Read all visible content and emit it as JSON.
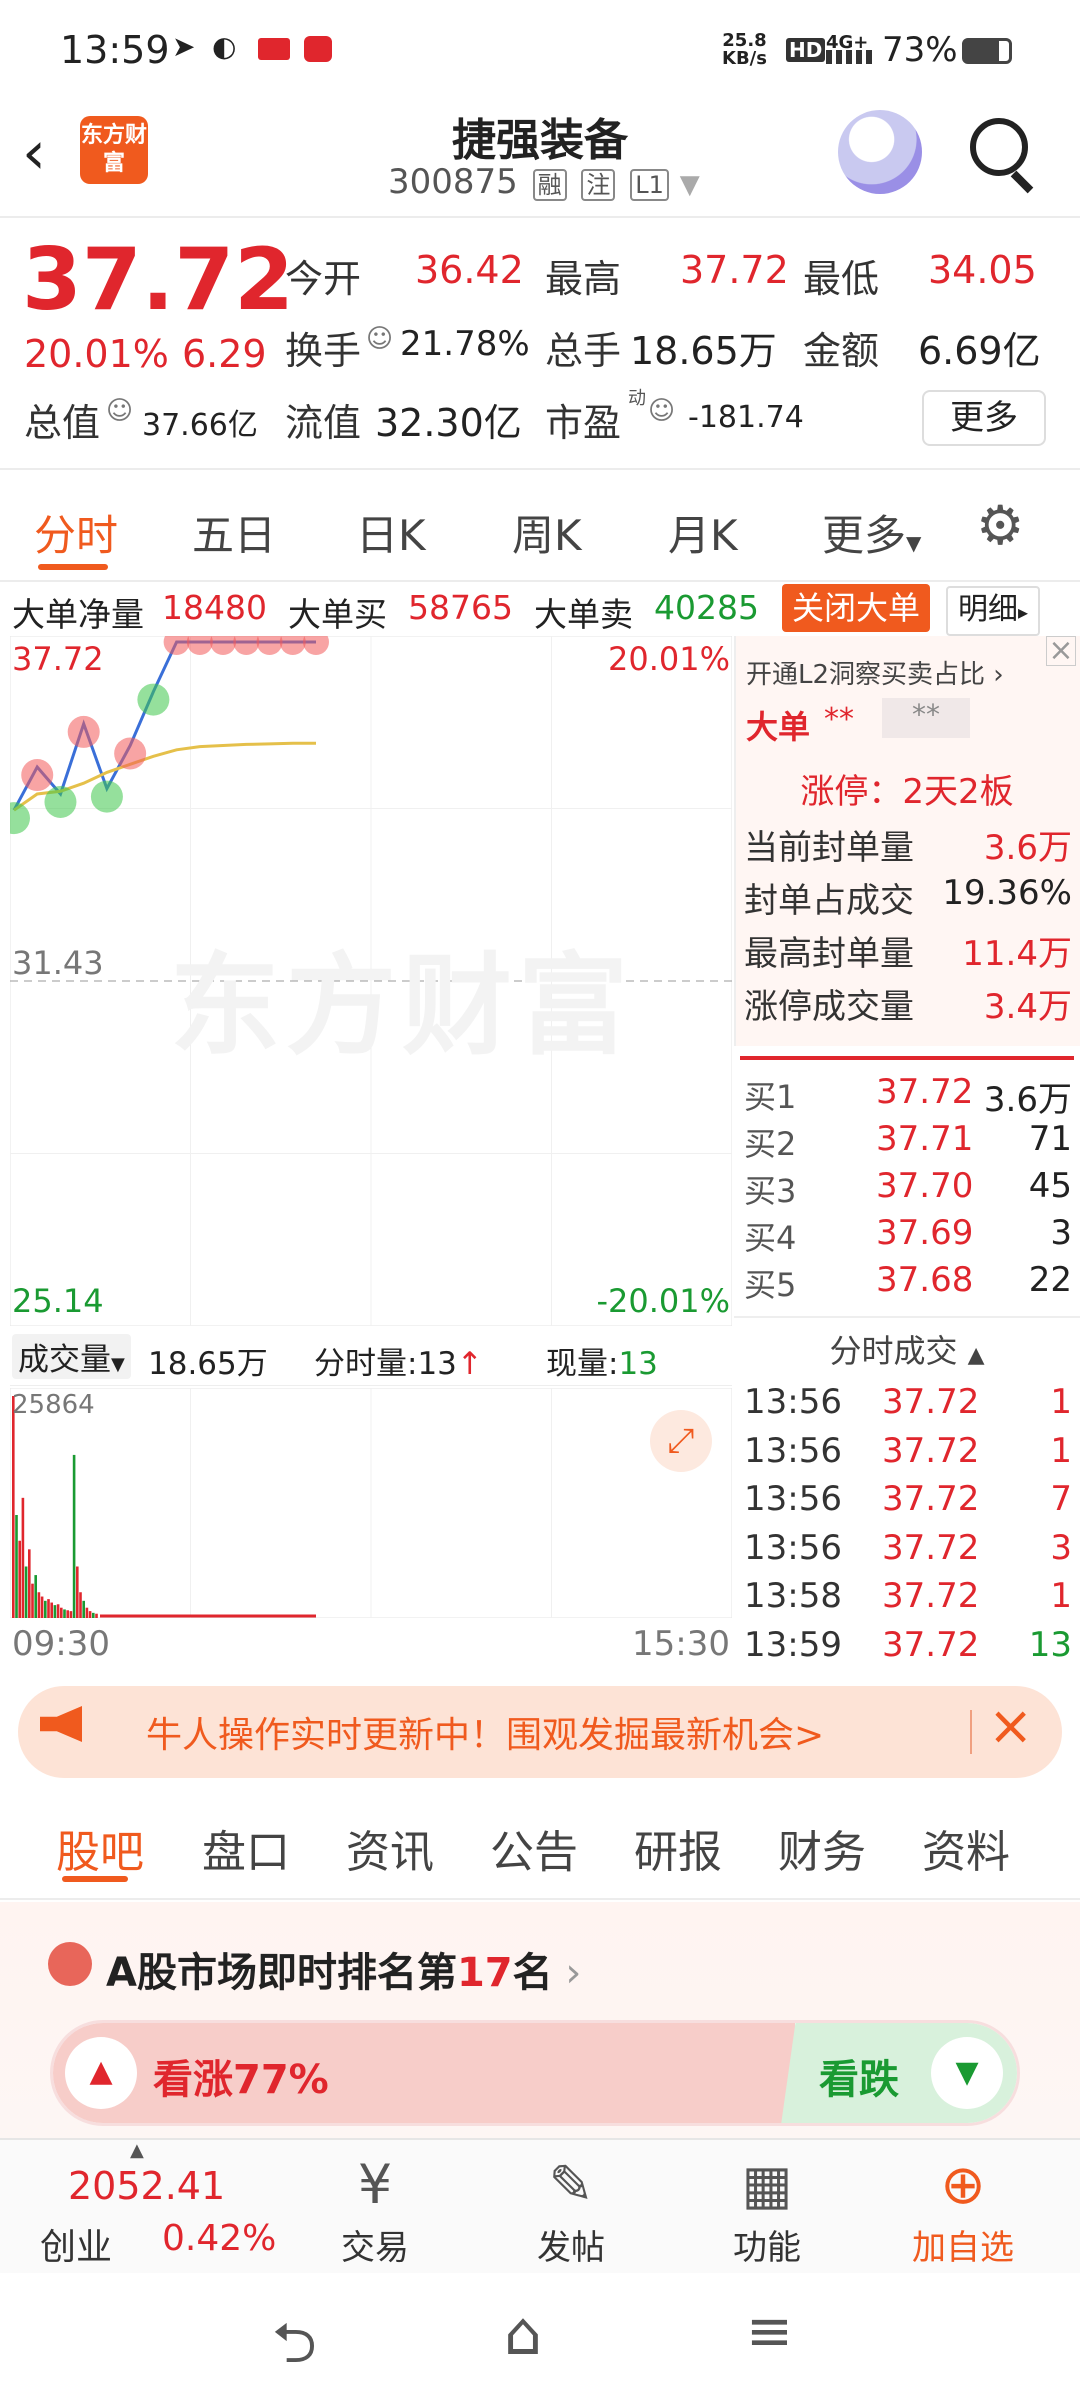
{
  "status_bar": {
    "time": "13:59",
    "net_speed_top": "25.8",
    "net_speed_bottom": "KB/s",
    "hd": "HD",
    "signal": "4G+",
    "battery": "73%"
  },
  "header": {
    "logo_text": "东方财富",
    "stock_name": "捷强装备",
    "stock_code": "300875",
    "tags": [
      "融",
      "注",
      "L1"
    ]
  },
  "quote": {
    "price": "37.72",
    "change_pct": "20.01%",
    "change_amt": "6.29",
    "labels": {
      "open": "今开",
      "high": "最高",
      "low": "最低",
      "turnover": "换手",
      "volume": "总手",
      "amount": "金额",
      "mktcap": "总值",
      "float_cap": "流值",
      "pe": "市盈",
      "pe_sup": "动"
    },
    "open": "36.42",
    "high": "37.72",
    "low": "34.05",
    "turnover": "21.78%",
    "volume": "18.65万",
    "amount": "6.69亿",
    "mktcap": "37.66亿",
    "float_cap": "32.30亿",
    "pe": "-181.74",
    "more_button": "更多"
  },
  "chart_tabs": [
    "分时",
    "五日",
    "日K",
    "周K",
    "月K",
    "更多"
  ],
  "big_order": {
    "net_label": "大单净量",
    "net_value": "18480",
    "buy_label": "大单买",
    "buy_value": "58765",
    "sell_label": "大单卖",
    "sell_value": "40285",
    "close_label": "关闭大单",
    "detail_label": "明细"
  },
  "chart_data": {
    "type": "line",
    "y_labels": {
      "top": "37.72",
      "mid": "31.43",
      "bottom": "25.14"
    },
    "pct_labels": {
      "top": "20.01%",
      "bottom": "-20.01%"
    },
    "x_labels": [
      "09:30",
      "15:30"
    ],
    "watermark": "东方财富",
    "ylim": [
      25.14,
      37.72
    ],
    "prev_close": 31.43,
    "price_series": [
      34.6,
      35.4,
      34.9,
      36.2,
      35.0,
      35.8,
      36.8,
      37.72,
      37.72,
      37.72,
      37.72,
      37.72,
      37.72,
      37.72
    ],
    "avg_series": [
      34.6,
      34.9,
      34.95,
      35.1,
      35.3,
      35.45,
      35.6,
      35.72,
      35.78,
      35.8,
      35.82,
      35.83,
      35.84,
      35.84
    ],
    "volume_max_label": "25864",
    "volume": [
      25864,
      12000,
      9000,
      14000,
      6000,
      8000,
      4000,
      5000,
      3000,
      2500,
      2000,
      2200,
      1800,
      1500,
      1600,
      1200,
      1000,
      900,
      800,
      19000,
      6000,
      3000,
      2000,
      1200,
      800,
      600,
      500
    ]
  },
  "volume_bar": {
    "label": "成交量",
    "value": "18.65万",
    "tick_label": "分时量:13",
    "now_label": "现量:",
    "now_value": "13"
  },
  "l2": {
    "title": "开通L2洞察买卖占比",
    "big_label": "大单",
    "big_v1": "**",
    "big_v2": "**"
  },
  "limit_up": {
    "title": "涨停：2天2板",
    "rows": [
      [
        "当前封单量",
        "3.6万"
      ],
      [
        "封单占成交",
        "19.36%"
      ],
      [
        "最高封单量",
        "11.4万"
      ],
      [
        "涨停成交量",
        "3.4万"
      ]
    ]
  },
  "order_book": [
    [
      "买1",
      "37.72",
      "3.6万"
    ],
    [
      "买2",
      "37.71",
      "71"
    ],
    [
      "买3",
      "37.70",
      "45"
    ],
    [
      "买4",
      "37.69",
      "3"
    ],
    [
      "买5",
      "37.68",
      "22"
    ]
  ],
  "ticks_title": "分时成交",
  "ticks": [
    [
      "13:56",
      "37.72",
      "1"
    ],
    [
      "13:56",
      "37.72",
      "1"
    ],
    [
      "13:56",
      "37.72",
      "7"
    ],
    [
      "13:56",
      "37.72",
      "3"
    ],
    [
      "13:58",
      "37.72",
      "1"
    ],
    [
      "13:59",
      "37.72",
      "13"
    ]
  ],
  "banner": {
    "text": "牛人操作实时更新中！围观发掘最新机会>"
  },
  "bottom_tabs": [
    "股吧",
    "盘口",
    "资讯",
    "公告",
    "研报",
    "财务",
    "资料"
  ],
  "rank": {
    "prefix": "A股市场即时排名第",
    "number": "17",
    "suffix": "名"
  },
  "sentiment": {
    "up_label": "看涨",
    "up_pct": "77%",
    "down_label": "看跌",
    "up_fraction": 0.77
  },
  "toolbar": {
    "index_value": "2052.41",
    "index_name": "创业",
    "index_change": "0.42%",
    "items": [
      "交易",
      "发帖",
      "功能",
      "加自选"
    ]
  },
  "colors": {
    "red": "#e0262d",
    "green": "#1a9a32",
    "orange": "#f05a1e"
  }
}
